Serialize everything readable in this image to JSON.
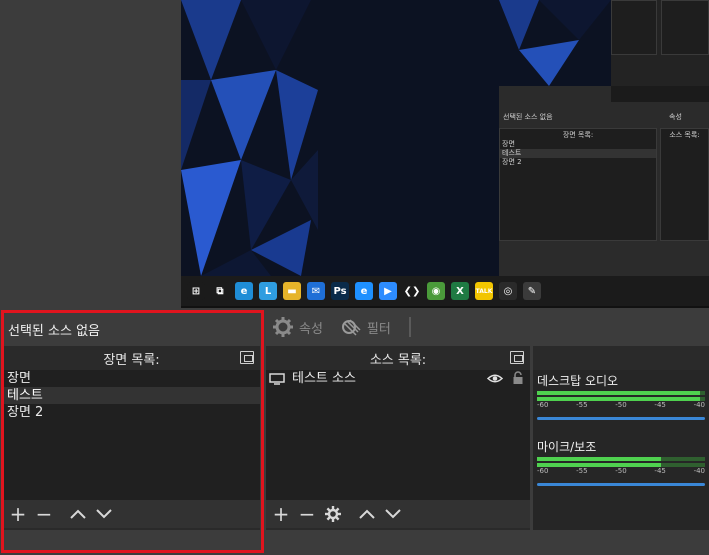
{
  "preview": {
    "nested": {
      "scene_items": [
        "장면",
        "테스트",
        "장면 2"
      ],
      "source_item": "테스트 소스",
      "no_source_label": "선택된 소스 없음",
      "properties_label": "속성",
      "filters_label": "필터",
      "scene_list_title": "장면 목록:",
      "source_list_title": "소스 목록:",
      "desktop_audio_label": "데스크탑 오디오",
      "mic_label": "마이크/보조",
      "meter_ticks": [
        "-60",
        "-55",
        "-50"
      ]
    },
    "taskbar_icons": [
      {
        "name": "start-icon",
        "glyph": "⊞",
        "color": "#1b1b1b"
      },
      {
        "name": "task-view-icon",
        "glyph": "⧉",
        "color": "#1b1b1b"
      },
      {
        "name": "edge-icon",
        "glyph": "e",
        "color": "#1f8dd6"
      },
      {
        "name": "l-app-icon",
        "glyph": "L",
        "color": "#2f9de0"
      },
      {
        "name": "file-explorer-icon",
        "glyph": "▬",
        "color": "#e6b42a"
      },
      {
        "name": "mail-icon",
        "glyph": "✉",
        "color": "#1f6fd6"
      },
      {
        "name": "photoshop-icon",
        "glyph": "Ps",
        "color": "#0a2b4a"
      },
      {
        "name": "ie-icon",
        "glyph": "e",
        "color": "#1e90ff"
      },
      {
        "name": "zoom-icon",
        "glyph": "▶",
        "color": "#2d8cff"
      },
      {
        "name": "vscode-icon",
        "glyph": "❮❯",
        "color": "#1b1b1b"
      },
      {
        "name": "chrome-icon",
        "glyph": "◉",
        "color": "#4a9a3a"
      },
      {
        "name": "excel-icon",
        "glyph": "X",
        "color": "#1f7a43"
      },
      {
        "name": "kakaotalk-icon",
        "glyph": "TALK",
        "color": "#f2c500"
      },
      {
        "name": "obs-icon",
        "glyph": "◎",
        "color": "#2a2a2a"
      },
      {
        "name": "paint-icon",
        "glyph": "✎",
        "color": "#3b3b3b"
      }
    ]
  },
  "context_bar": {
    "no_source_label": "선택된 소스 없음",
    "properties_label": "속성",
    "filters_label": "필터"
  },
  "scene_dock": {
    "title": "장면 목록:",
    "items": [
      {
        "label": "장면",
        "selected": false
      },
      {
        "label": "테스트",
        "selected": true
      },
      {
        "label": "장면 2",
        "selected": false
      }
    ]
  },
  "source_dock": {
    "title": "소스 목록:",
    "items": [
      {
        "label": "테스트 소스",
        "visible": true,
        "locked": false
      }
    ]
  },
  "mixer_dock": {
    "channels": [
      {
        "label": "데스크탑 오디오",
        "level": 0.97
      },
      {
        "label": "마이크/보조",
        "level": 0.74
      }
    ],
    "ticks": [
      "-60",
      "-55",
      "-50",
      "-45",
      "-40"
    ]
  },
  "colors": {
    "highlight": "#e0141e",
    "meter_green": "#4fd14f",
    "slider_blue": "#3a87d6"
  }
}
